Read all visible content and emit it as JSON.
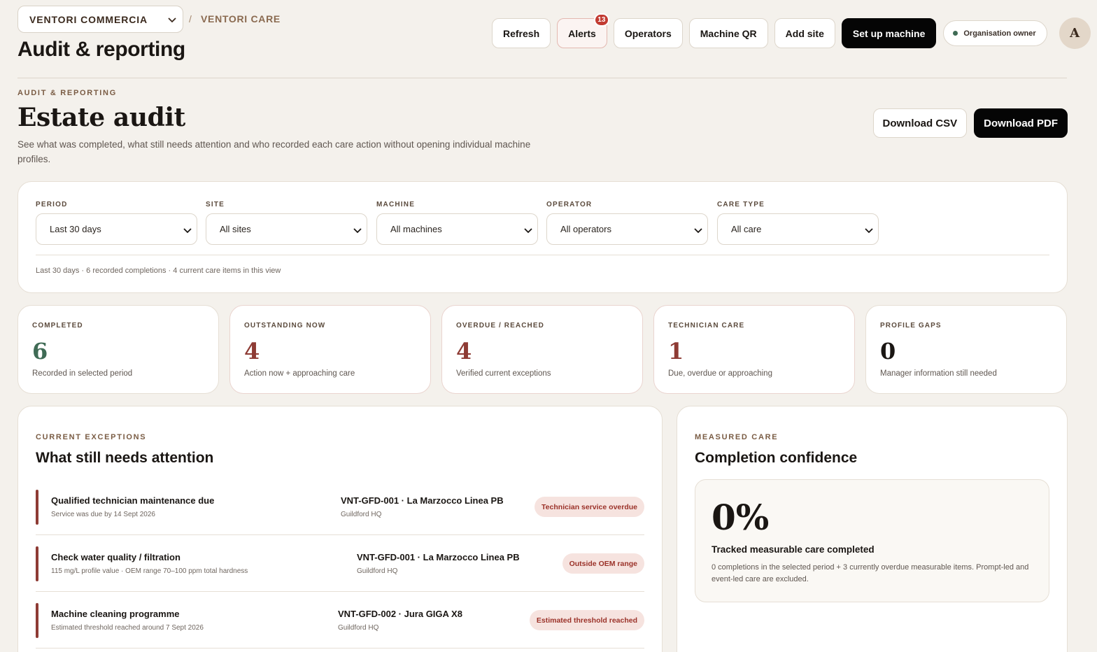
{
  "header": {
    "org_select": "VENTORI COMMERCIA",
    "breadcrumb_sep": "/",
    "breadcrumb_current": "VENTORI CARE",
    "app_title": "Audit & reporting",
    "actions": {
      "refresh": "Refresh",
      "alerts": "Alerts",
      "alerts_count": "13",
      "operators": "Operators",
      "machine_qr": "Machine QR",
      "add_site": "Add site",
      "set_up_machine": "Set up machine"
    },
    "role": "Organisation owner",
    "avatar_initial": "A"
  },
  "section": {
    "eyebrow": "AUDIT & REPORTING",
    "title": "Estate audit",
    "description": "See what was completed, what still needs attention and who recorded each care action without opening individual machine profiles.",
    "download_csv": "Download CSV",
    "download_pdf": "Download PDF"
  },
  "filters": {
    "items": [
      {
        "label": "PERIOD",
        "value": "Last 30 days"
      },
      {
        "label": "SITE",
        "value": "All sites"
      },
      {
        "label": "MACHINE",
        "value": "All machines"
      },
      {
        "label": "OPERATOR",
        "value": "All operators"
      },
      {
        "label": "CARE TYPE",
        "value": "All care"
      }
    ],
    "summary": "Last 30 days · 6 recorded completions · 4 current care items in this view"
  },
  "stats": [
    {
      "label": "COMPLETED",
      "value": "6",
      "sub": "Recorded in selected period",
      "color": "#3f6b55"
    },
    {
      "label": "OUTSTANDING NOW",
      "value": "4",
      "sub": "Action now + approaching care",
      "color": "#8e3b34"
    },
    {
      "label": "OVERDUE / REACHED",
      "value": "4",
      "sub": "Verified current exceptions",
      "color": "#8e3b34"
    },
    {
      "label": "TECHNICIAN CARE",
      "value": "1",
      "sub": "Due, overdue or approaching",
      "color": "#8e3b34"
    },
    {
      "label": "PROFILE GAPS",
      "value": "0",
      "sub": "Manager information still needed",
      "color": "#1a1613"
    }
  ],
  "exceptions": {
    "eyebrow": "CURRENT EXCEPTIONS",
    "title": "What still needs attention",
    "rows": [
      {
        "title": "Qualified technician maintenance due",
        "sub": "Service was due by 14 Sept 2026",
        "machine": "VNT-GFD-001 · La Marzocco Linea PB",
        "site": "Guildford HQ",
        "tag": "Technician service overdue"
      },
      {
        "title": "Check water quality / filtration",
        "sub": "115 mg/L profile value · OEM range 70–100 ppm total hardness",
        "machine": "VNT-GFD-001 · La Marzocco Linea PB",
        "site": "Guildford HQ",
        "tag": "Outside OEM range"
      },
      {
        "title": "Machine cleaning programme",
        "sub": "Estimated threshold reached around 7 Sept 2026",
        "machine": "VNT-GFD-002 · Jura GIGA X8",
        "site": "Guildford HQ",
        "tag": "Estimated threshold reached"
      }
    ]
  },
  "confidence": {
    "eyebrow": "MEASURED CARE",
    "title": "Completion confidence",
    "value": "0%",
    "label": "Tracked measurable care completed",
    "description": "0 completions in the selected period + 3 currently overdue measurable items. Prompt-led and event-led care are excluded."
  }
}
